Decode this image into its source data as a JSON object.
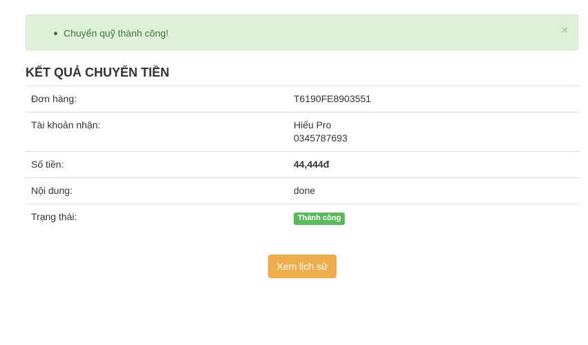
{
  "alert": {
    "message": "Chuyển quỹ thành công!",
    "close_symbol": "×"
  },
  "heading": "KẾT QUẢ CHUYỂN TIỀN",
  "rows": {
    "order": {
      "label": "Đơn hàng:",
      "value": "T6190FE8903551"
    },
    "account": {
      "label": "Tài khoản nhận:",
      "name": "Hiếu Pro",
      "number": "0345787693"
    },
    "amount": {
      "label": "Số tiền:",
      "value": "44,444đ"
    },
    "content": {
      "label": "Nội dung:",
      "value": "done"
    },
    "status": {
      "label": "Trạng thái:",
      "badge": "Thành công"
    }
  },
  "actions": {
    "history_label": "Xem lịch sử"
  },
  "colors": {
    "success_bg": "#dff0d8",
    "success_text": "#3c763d",
    "badge_green": "#5cb85c",
    "button_orange": "#f0ad4e"
  }
}
